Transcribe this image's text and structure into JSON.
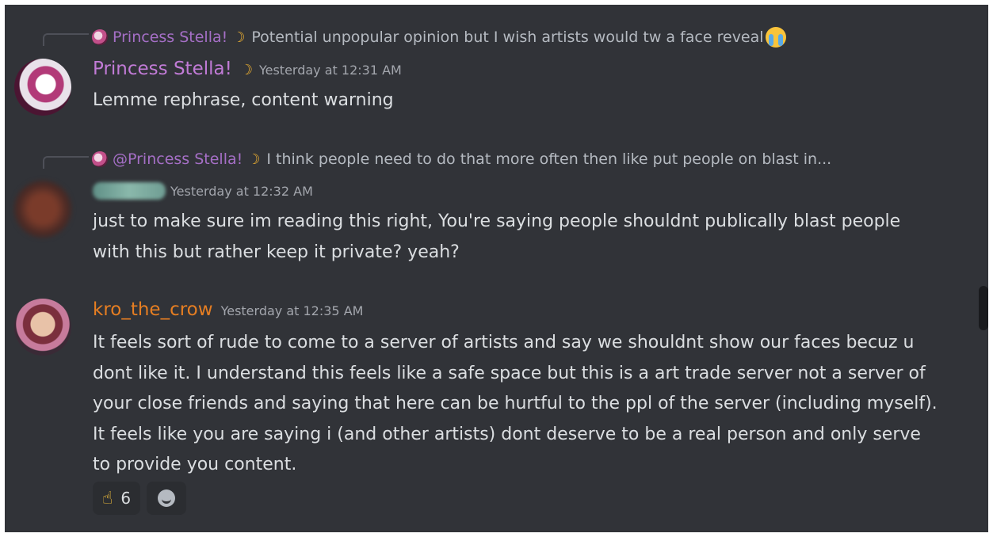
{
  "messages": [
    {
      "reply": {
        "author": "Princess Stella!",
        "icon": "crescent-moon",
        "text": "Potential unpopular opinion but I wish artists would tw a face reveal",
        "emoji": "loudly-crying-face"
      },
      "author": "Princess Stella!",
      "author_color": "#c17bd6",
      "timestamp": "Yesterday at 12:31 AM",
      "text": "Lemme rephrase, content warning"
    },
    {
      "reply": {
        "mention": "@Princess Stella!",
        "icon": "crescent-moon",
        "text": "I think people need to do that more often then like put people on blast in..."
      },
      "author": "",
      "timestamp": "Yesterday at 12:32 AM",
      "text": "just to make sure im reading this right, You're saying people shouldnt publically blast people with this but rather keep it private? yeah?"
    },
    {
      "author": "kro_the_crow",
      "author_color": "#e67e22",
      "timestamp": "Yesterday at 12:35 AM",
      "text": "It feels sort of rude to come to a server of artists and say we shouldnt show our faces becuz u dont like it. I understand this feels like a safe space but this is a art trade server not a server of your close friends and saying that here can be hurtful to the ppl of the server (including myself). It feels like you are saying i (and other artists) dont deserve to be a real person and only serve to provide you content.",
      "reactions": [
        {
          "emoji": "pointing-up-hand",
          "count": "6"
        }
      ],
      "add_reaction_icon": "smile-icon"
    }
  ],
  "colors": {
    "background": "#313338",
    "text": "#dbdee1",
    "timestamp": "#a3a6ad",
    "reply_name": "#a56fc6"
  }
}
